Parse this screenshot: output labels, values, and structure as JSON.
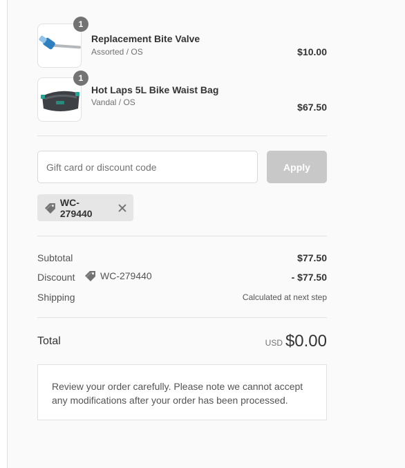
{
  "products": [
    {
      "name": "Replacement Bite Valve",
      "variant": "Assorted / OS",
      "price": "$10.00",
      "quantity": "1",
      "image_icon": "bite-valve-image"
    },
    {
      "name": "Hot Laps 5L Bike Waist Bag",
      "variant": "Vandal / OS",
      "price": "$67.50",
      "quantity": "1",
      "image_icon": "waist-bag-image"
    }
  ],
  "discount_form": {
    "placeholder": "Gift card or discount code",
    "apply_label": "Apply"
  },
  "applied_code": {
    "code": "WC-279440",
    "icon": "tag-icon"
  },
  "summary": {
    "subtotal_label": "Subtotal",
    "subtotal_value": "$77.50",
    "discount_label": "Discount",
    "discount_code": "WC-279440",
    "discount_value": "- $77.50",
    "shipping_label": "Shipping",
    "shipping_value": "Calculated at next step"
  },
  "total": {
    "label": "Total",
    "currency": "USD",
    "value": "$0.00"
  },
  "note": "Review your order carefully. Please note we cannot accept any modifications after your order has been processed.",
  "colors": {
    "background": "#fafafa",
    "badge": "#737373",
    "apply_disabled": "#c8c8c8",
    "chip": "#e6e6e6"
  }
}
